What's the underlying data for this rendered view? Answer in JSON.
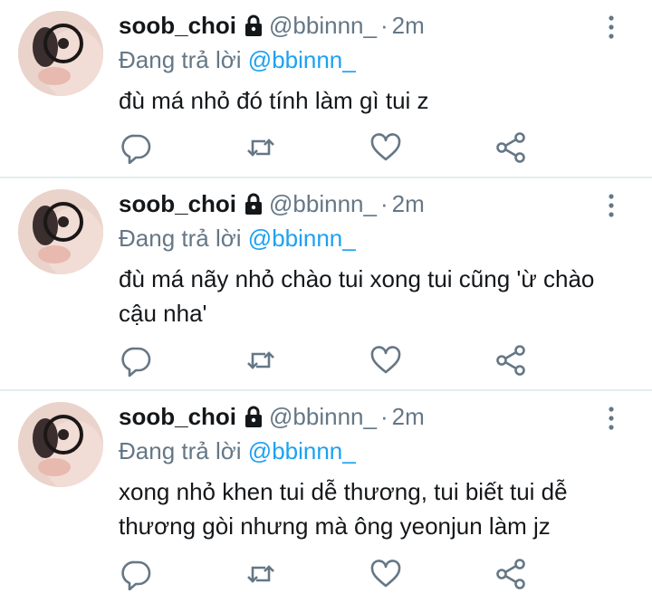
{
  "colors": {
    "text": "#14171a",
    "secondary": "#657786",
    "mention": "#1da1f2",
    "divider": "#e6ecf0",
    "icon": "#657786"
  },
  "tweets": [
    {
      "display_name": "soob_choi",
      "handle": "@bbinnn_",
      "separator": "·",
      "time": "2m",
      "reply_prefix": "Đang trả lời",
      "reply_to": "@bbinnn_",
      "text": "đù má nhỏ đó tính làm gì tui z"
    },
    {
      "display_name": "soob_choi",
      "handle": "@bbinnn_",
      "separator": "·",
      "time": "2m",
      "reply_prefix": "Đang trả lời",
      "reply_to": "@bbinnn_",
      "text": "đù má nãy nhỏ chào tui xong tui cũng 'ừ chào cậu nha'"
    },
    {
      "display_name": "soob_choi",
      "handle": "@bbinnn_",
      "separator": "·",
      "time": "2m",
      "reply_prefix": "Đang trả lời",
      "reply_to": "@bbinnn_",
      "text": "xong nhỏ khen tui dễ thương, tui biết tui dễ thương gòi nhưng mà ông yeonjun làm jz"
    }
  ],
  "icons": {
    "lock": "lock-icon",
    "more": "more-vertical-icon",
    "reply": "reply-icon",
    "retweet": "retweet-icon",
    "like": "heart-icon",
    "share": "share-icon"
  }
}
